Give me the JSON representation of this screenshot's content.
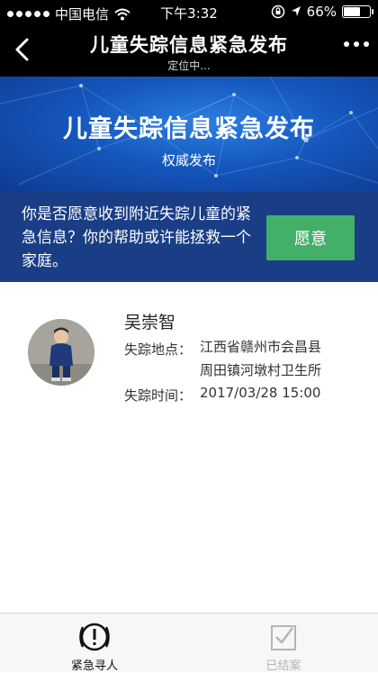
{
  "status_bar": {
    "carrier": "中国电信",
    "time": "下午3:32",
    "battery_text": "66%",
    "battery_level": 0.66,
    "icons": [
      "signal-dots-icon",
      "wifi-icon",
      "orientation-lock-icon",
      "location-arrow-icon",
      "battery-icon"
    ]
  },
  "nav": {
    "title": "儿童失踪信息紧急发布",
    "subtitle": "定位中...",
    "icons": [
      "back-chevron-icon",
      "more-dots-icon"
    ]
  },
  "banner": {
    "headline": "儿童失踪信息紧急发布",
    "subtitle": "权威发布"
  },
  "prompt": {
    "text": "你是否愿意收到附近失踪儿童的紧急信息？你的帮助或许能拯救一个家庭。",
    "button_label": "愿意"
  },
  "case": {
    "name": "吴崇智",
    "location_label": "失踪地点：",
    "location_line1": "江西省赣州市会昌县",
    "location_line2": "周田镇河墩村卫生所",
    "time_label": "失踪时间：",
    "time_value": "2017/03/28 15:00"
  },
  "tabs": [
    {
      "label": "紧急寻人",
      "icon": "alert-circle-icon",
      "active": true
    },
    {
      "label": "已结案",
      "icon": "checkbox-icon",
      "active": false
    }
  ],
  "colors": {
    "nav_bg": "#000000",
    "banner_blue": "#1557bd",
    "prompt_bg": "#1a3e85",
    "agree_green": "#43b06a",
    "tab_active": "#111111",
    "tab_inactive": "#b5b5b5"
  }
}
